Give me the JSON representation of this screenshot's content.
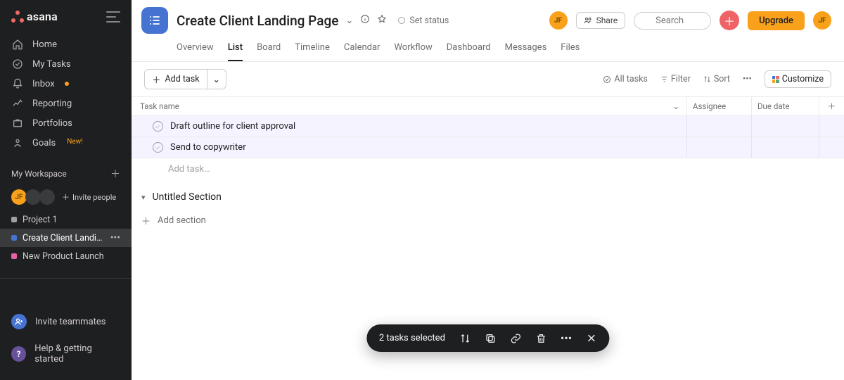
{
  "brand": {
    "name": "asana"
  },
  "sidebar": {
    "nav": [
      {
        "label": "Home"
      },
      {
        "label": "My Tasks"
      },
      {
        "label": "Inbox",
        "has_notif": true
      },
      {
        "label": "Reporting"
      },
      {
        "label": "Portfolios"
      },
      {
        "label": "Goals",
        "badge": "New!"
      }
    ],
    "workspace_label": "My Workspace",
    "member_initials": "JF",
    "invite_people_label": "Invite people",
    "projects": [
      {
        "name": "Project 1",
        "color": "#a2a0a2"
      },
      {
        "name": "Create Client Landin…",
        "color": "#4573d2",
        "active": true
      },
      {
        "name": "New Product Launch",
        "color": "#e362a4"
      }
    ],
    "invite_teammates_label": "Invite teammates",
    "help_label": "Help & getting started"
  },
  "header": {
    "project_title": "Create Client Landing Page",
    "set_status_label": "Set status",
    "share_label": "Share",
    "search_placeholder": "Search",
    "upgrade_label": "Upgrade",
    "avatar_initials": "JF",
    "tabs": [
      "Overview",
      "List",
      "Board",
      "Timeline",
      "Calendar",
      "Workflow",
      "Dashboard",
      "Messages",
      "Files"
    ],
    "active_tab": "List"
  },
  "toolbar": {
    "add_task_label": "Add task",
    "all_tasks_label": "All tasks",
    "filter_label": "Filter",
    "sort_label": "Sort",
    "customize_label": "Customize"
  },
  "columns": {
    "task": "Task name",
    "assignee": "Assignee",
    "due": "Due date"
  },
  "tasks": [
    {
      "name": "Draft outline for client approval"
    },
    {
      "name": "Send to copywriter"
    }
  ],
  "add_task_row_placeholder": "Add task…",
  "section_name": "Untitled Section",
  "add_section_label": "Add section",
  "selection": {
    "label": "2 tasks selected"
  }
}
